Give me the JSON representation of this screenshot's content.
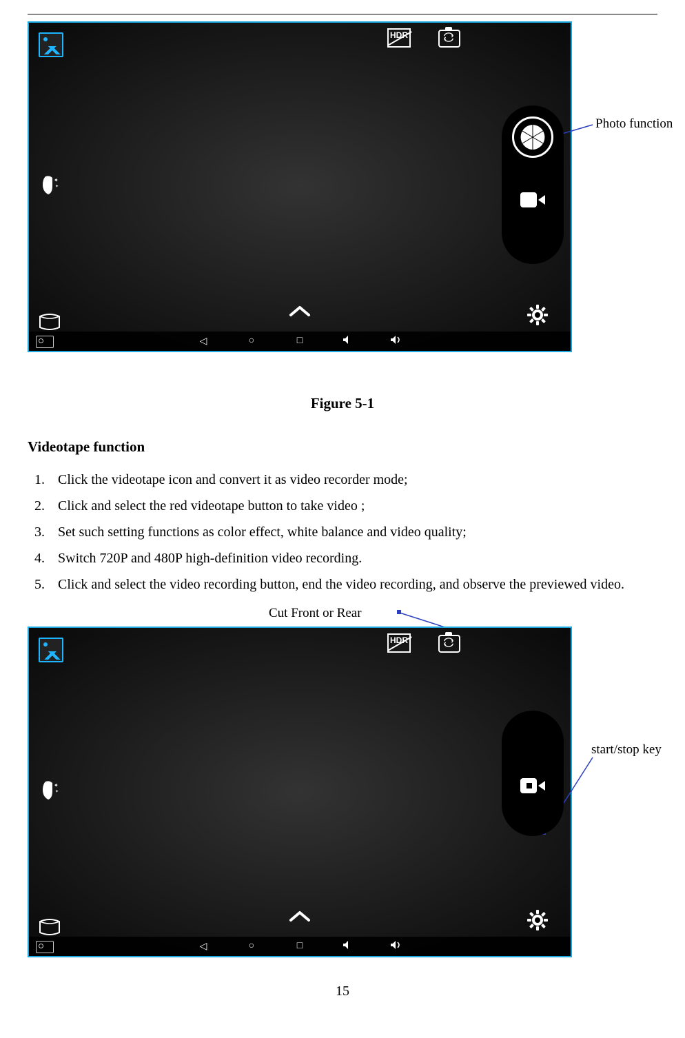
{
  "figure1": {
    "caption": "Figure 5-1",
    "annotations": {
      "photo": "Photo function"
    },
    "icons": {
      "hdr": "HDR",
      "switch_camera": "switch-camera",
      "gallery": "gallery",
      "face_beauty": "face-beauty",
      "panorama": "panorama",
      "shutter": "photo-shutter",
      "video": "video-mode",
      "chevron": "chevron-up",
      "settings": "settings",
      "nav_back": "back",
      "nav_home": "home",
      "nav_recent": "recent",
      "nav_vol_down": "volume-down",
      "nav_vol_up": "volume-up",
      "nav_screenshot": "screenshot"
    }
  },
  "section": {
    "title": "Videotape function",
    "steps": [
      "Click the videotape icon and convert it as video recorder mode;",
      "Click and select the red videotape button to take video ;",
      "Set such setting functions as color effect, white balance and video quality;",
      "Switch 720P and 480P high-definition video recording.",
      "Click and select the video recording button, end the video recording, and observe the previewed video."
    ]
  },
  "figure2": {
    "annotations": {
      "cut": "Cut Front or Rear",
      "start_stop": "start/stop key"
    }
  },
  "page_number": "15"
}
